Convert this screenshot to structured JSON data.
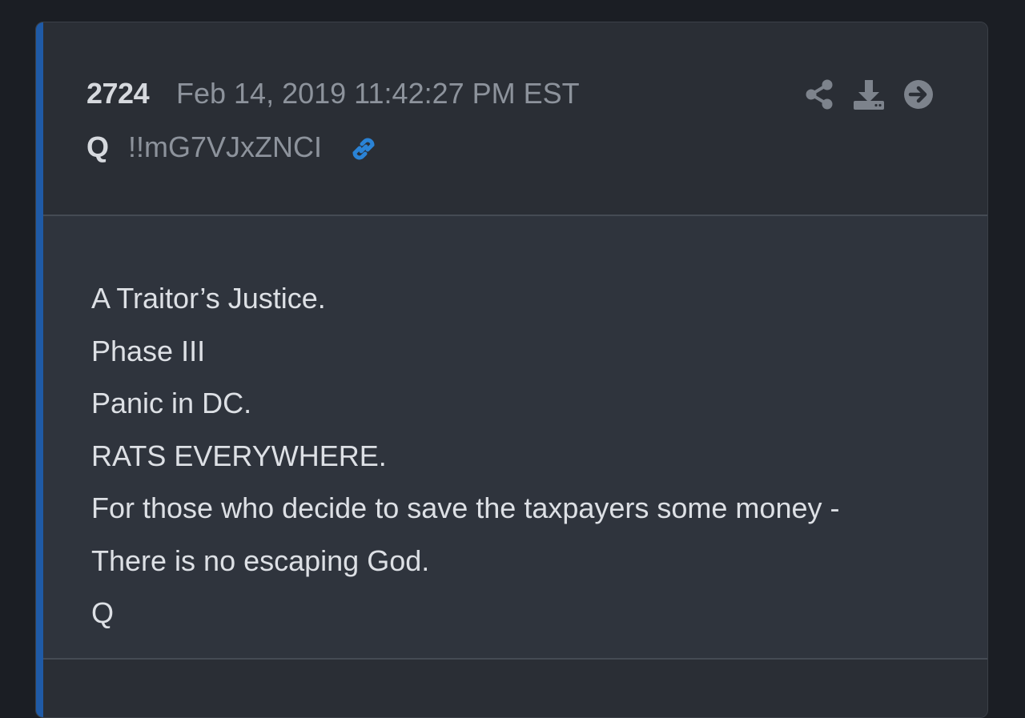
{
  "post": {
    "number": "2724",
    "date": "Feb 14, 2019 11:42:27 PM EST",
    "author": "Q",
    "tripcode": "!!mG7VJxZNCI",
    "body_lines": [
      "A Traitor’s Justice.",
      "Phase III",
      "Panic in DC.",
      "RATS EVERYWHERE.",
      "For those who decide to save the taxpayers some money -",
      "There is no escaping God.",
      "Q"
    ]
  },
  "icons": {
    "link": "link-icon",
    "share": "share-icon",
    "download": "download-icon",
    "next": "arrow-right-circle-icon"
  },
  "colors": {
    "background": "#1b1e24",
    "card": "#2a2e35",
    "body": "#2f343d",
    "accent": "#1f5aa6",
    "link": "#2a83d6",
    "muted_text": "#8d939c",
    "text": "#dde0e5"
  }
}
